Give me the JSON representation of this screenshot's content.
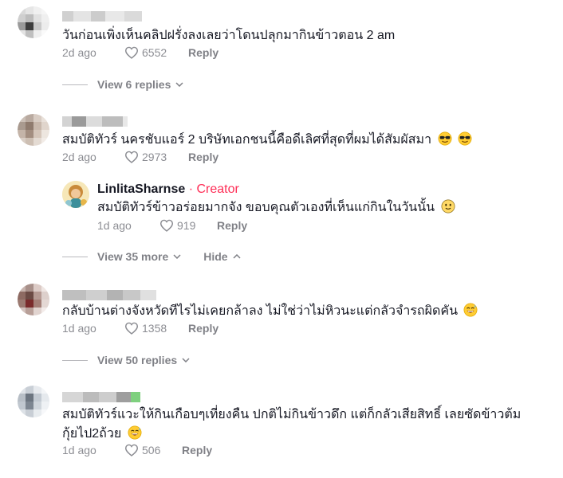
{
  "comments": [
    {
      "text": "วันก่อนเพิ่งเห็นคลิปฝรั่งลงเลยว่าโดนปลุกมากินข้าวตอน 2 am",
      "date": "2d ago",
      "likes": "6552",
      "reply_label": "Reply",
      "view_replies_label": "View 6 replies"
    },
    {
      "text": "สมบัติทัวร์ นครชับแอร์ 2 บริษัทเอกชนนี้คือดีเลิศที่สุดที่ผมได้สัมผัสมา",
      "emoji": [
        "sunglasses-emoji",
        "sunglasses-emoji"
      ],
      "date": "2d ago",
      "likes": "2973",
      "reply_label": "Reply",
      "reply": {
        "username": "LinlitaSharnse",
        "separator": " · ",
        "badge": "Creator",
        "text": "สมบัติทัวร์ข้าวอร่อยมากจัง ขอบคุณตัวเองที่เห็นแก่กินในวันนั้น",
        "emoji": "slight-smile-emoji",
        "date": "1d ago",
        "likes": "919",
        "reply_label": "Reply"
      },
      "view_more_label": "View 35 more",
      "hide_label": "Hide"
    },
    {
      "text": "กลับบ้านต่างจังหวัดทีไรไม่เคยกล้าลง ไม่ใช่ว่าไม่หิวนะแต่กลัวจำรถผิดคัน",
      "emoji": "grinning-sweat-emoji",
      "date": "1d ago",
      "likes": "1358",
      "reply_label": "Reply",
      "view_replies_label": "View 50 replies"
    },
    {
      "text_line1": "สมบัติทัวร์แวะให้กินเกือบๆเที่ยงคืน ปกติไม่กินข้าวดึก แต่ก็กลัวเสียสิทธิ์ เลยซัดข้าวต้ม",
      "text_line2": "กุ้ยไป2ถ้วย",
      "emoji": "grinning-sweat-emoji",
      "date": "1d ago",
      "likes": "506",
      "reply_label": "Reply"
    }
  ],
  "colors": {
    "accent": "#fe2c55",
    "text": "#161823",
    "muted": "rgba(22,24,35,0.5)"
  }
}
